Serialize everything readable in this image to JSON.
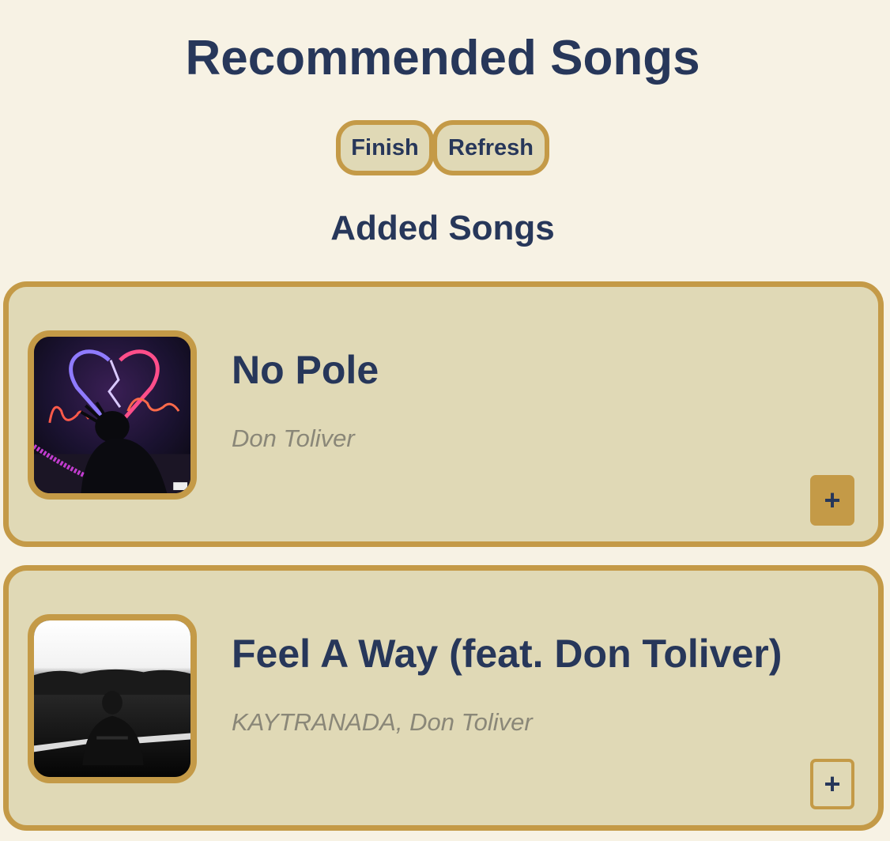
{
  "header": {
    "title": "Recommended Songs",
    "finish_label": "Finish",
    "refresh_label": "Refresh",
    "subtitle": "Added Songs"
  },
  "songs": [
    {
      "title": "No Pole",
      "artist": "Don Toliver",
      "add_label": "+",
      "artwork": "album-cover-love-sick"
    },
    {
      "title": "Feel A Way (feat. Don Toliver)",
      "artist": "KAYTRANADA, Don Toliver",
      "add_label": "+",
      "artwork": "album-cover-dark-figure"
    }
  ],
  "colors": {
    "background": "#f7f2e4",
    "card": "#e0d9b6",
    "accent": "#c49a47",
    "text": "#27375a",
    "muted": "#8a8778"
  }
}
